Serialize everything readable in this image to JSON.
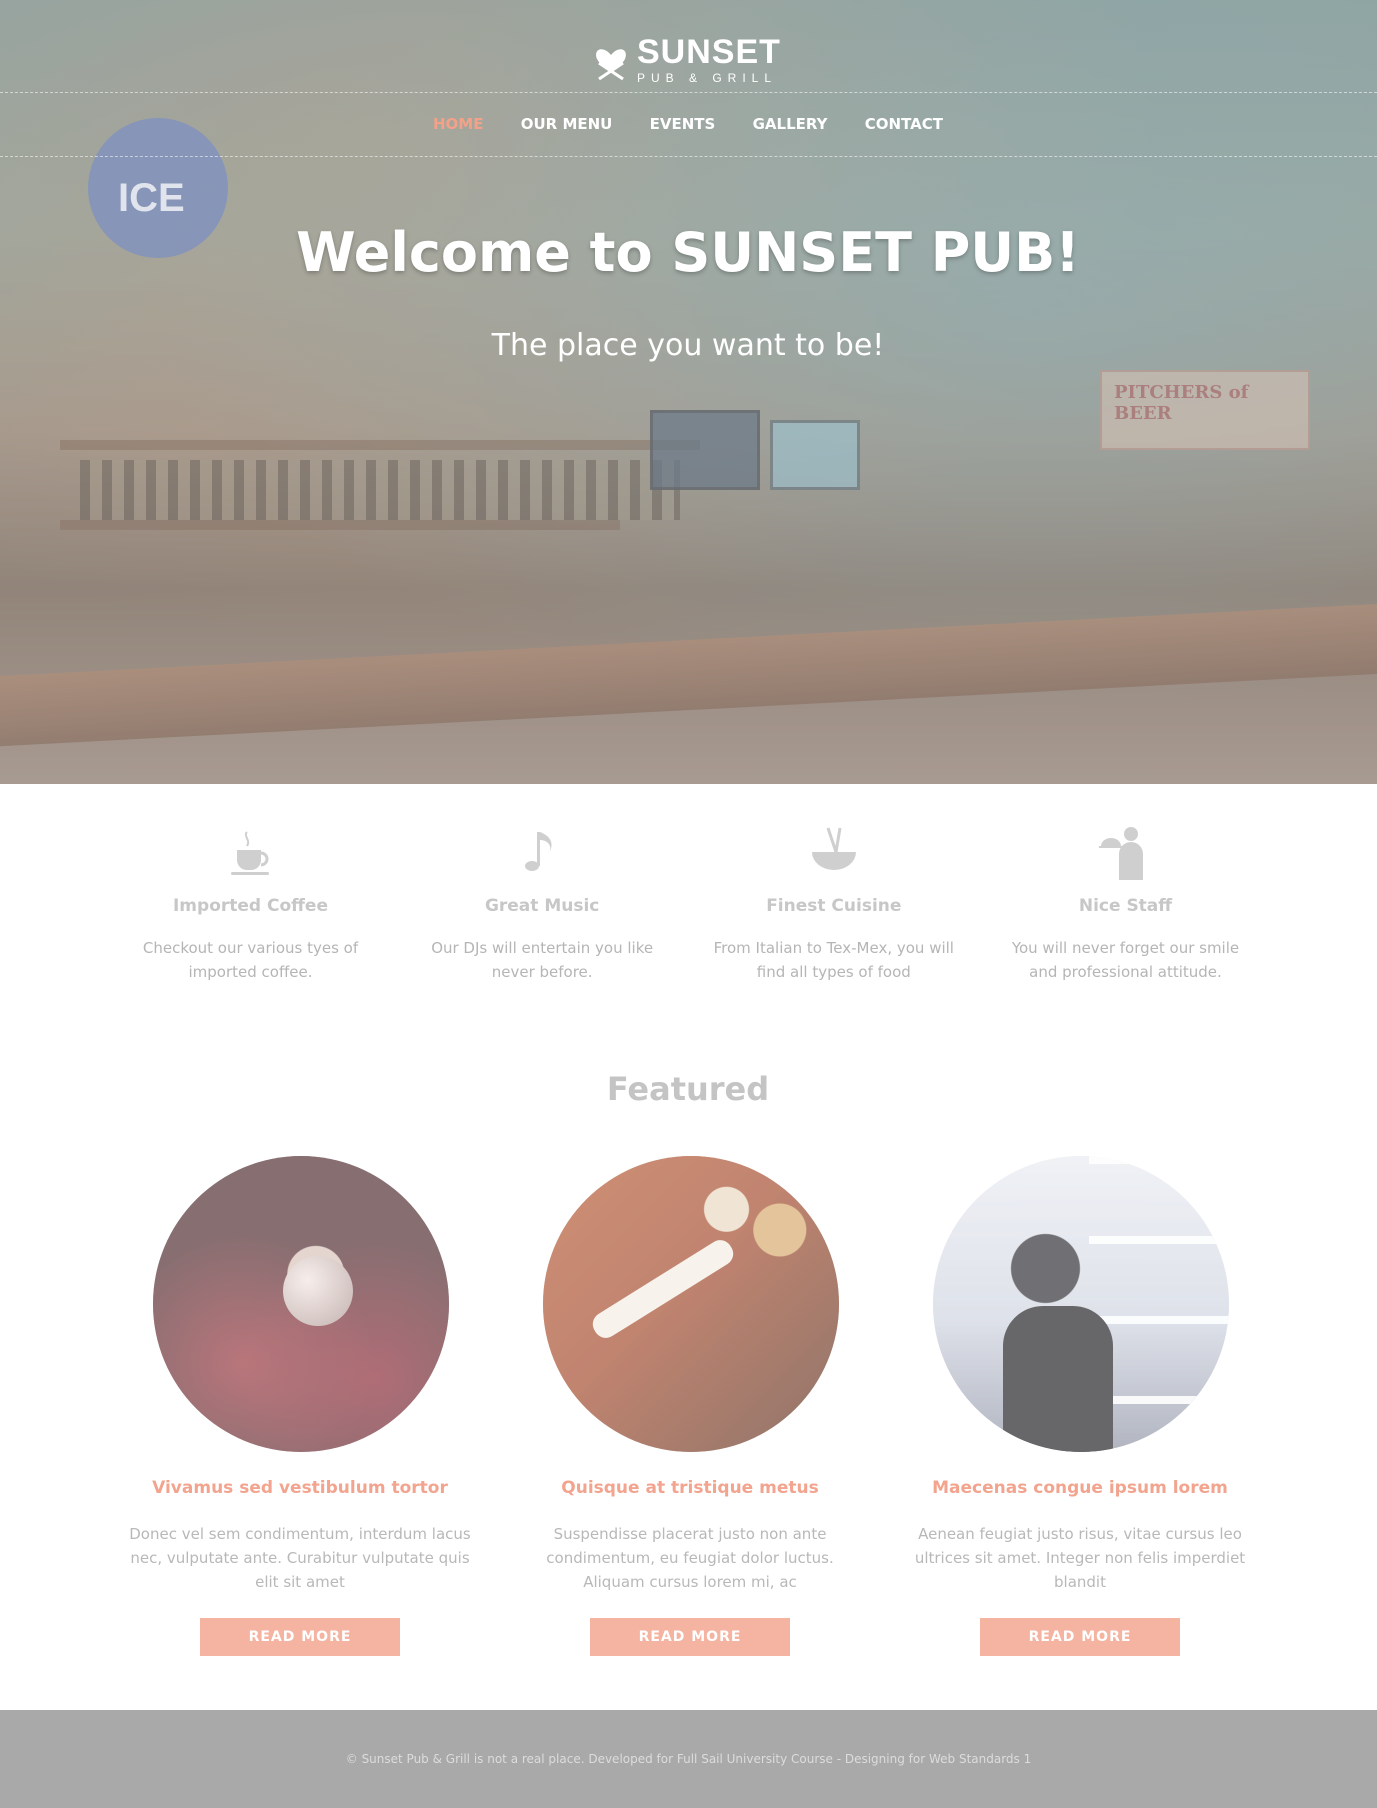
{
  "brand": {
    "name": "SUNSET",
    "subtitle": "PUB & GRILL"
  },
  "nav": {
    "items": [
      {
        "label": "HOME",
        "active": true
      },
      {
        "label": "OUR MENU",
        "active": false
      },
      {
        "label": "EVENTS",
        "active": false
      },
      {
        "label": "GALLERY",
        "active": false
      },
      {
        "label": "CONTACT",
        "active": false
      }
    ]
  },
  "hero": {
    "title": "Welcome to SUNSET PUB!",
    "subtitle": "The place you want to be!"
  },
  "features": [
    {
      "icon": "coffee-cup-icon",
      "title": "Imported Coffee",
      "description": "Checkout our various tyes of imported coffee."
    },
    {
      "icon": "music-note-icon",
      "title": "Great Music",
      "description": "Our DJs will entertain you like never before."
    },
    {
      "icon": "noodle-bowl-icon",
      "title": "Finest Cuisine",
      "description": "From Italian to Tex-Mex, you will find all types of food"
    },
    {
      "icon": "waiter-icon",
      "title": "Nice Staff",
      "description": "You will never forget our smile and professional attitude."
    }
  ],
  "featured": {
    "heading": "Featured",
    "cards": [
      {
        "title": "Vivamus sed vestibulum tortor",
        "description": "Donec vel sem condimentum, interdum lacus nec, vulputate ante. Curabitur vulputate quis elit sit amet",
        "button": "READ MORE"
      },
      {
        "title": "Quisque at tristique metus",
        "description": "Suspendisse placerat justo non ante condimentum, eu feugiat dolor luctus. Aliquam cursus lorem mi, ac",
        "button": "READ MORE"
      },
      {
        "title": "Maecenas congue ipsum lorem",
        "description": "Aenean feugiat justo risus, vitae cursus leo ultrices sit amet. Integer non felis imperdiet blandit",
        "button": "READ MORE"
      }
    ]
  },
  "footer": {
    "text": "© Sunset Pub & Grill is not a real place. Developed for Full Sail University Course - Designing for Web Standards 1"
  },
  "colors": {
    "accent": "#f4a18a",
    "button": "#f4b4a1",
    "footer_bg": "#a9a9a9"
  }
}
